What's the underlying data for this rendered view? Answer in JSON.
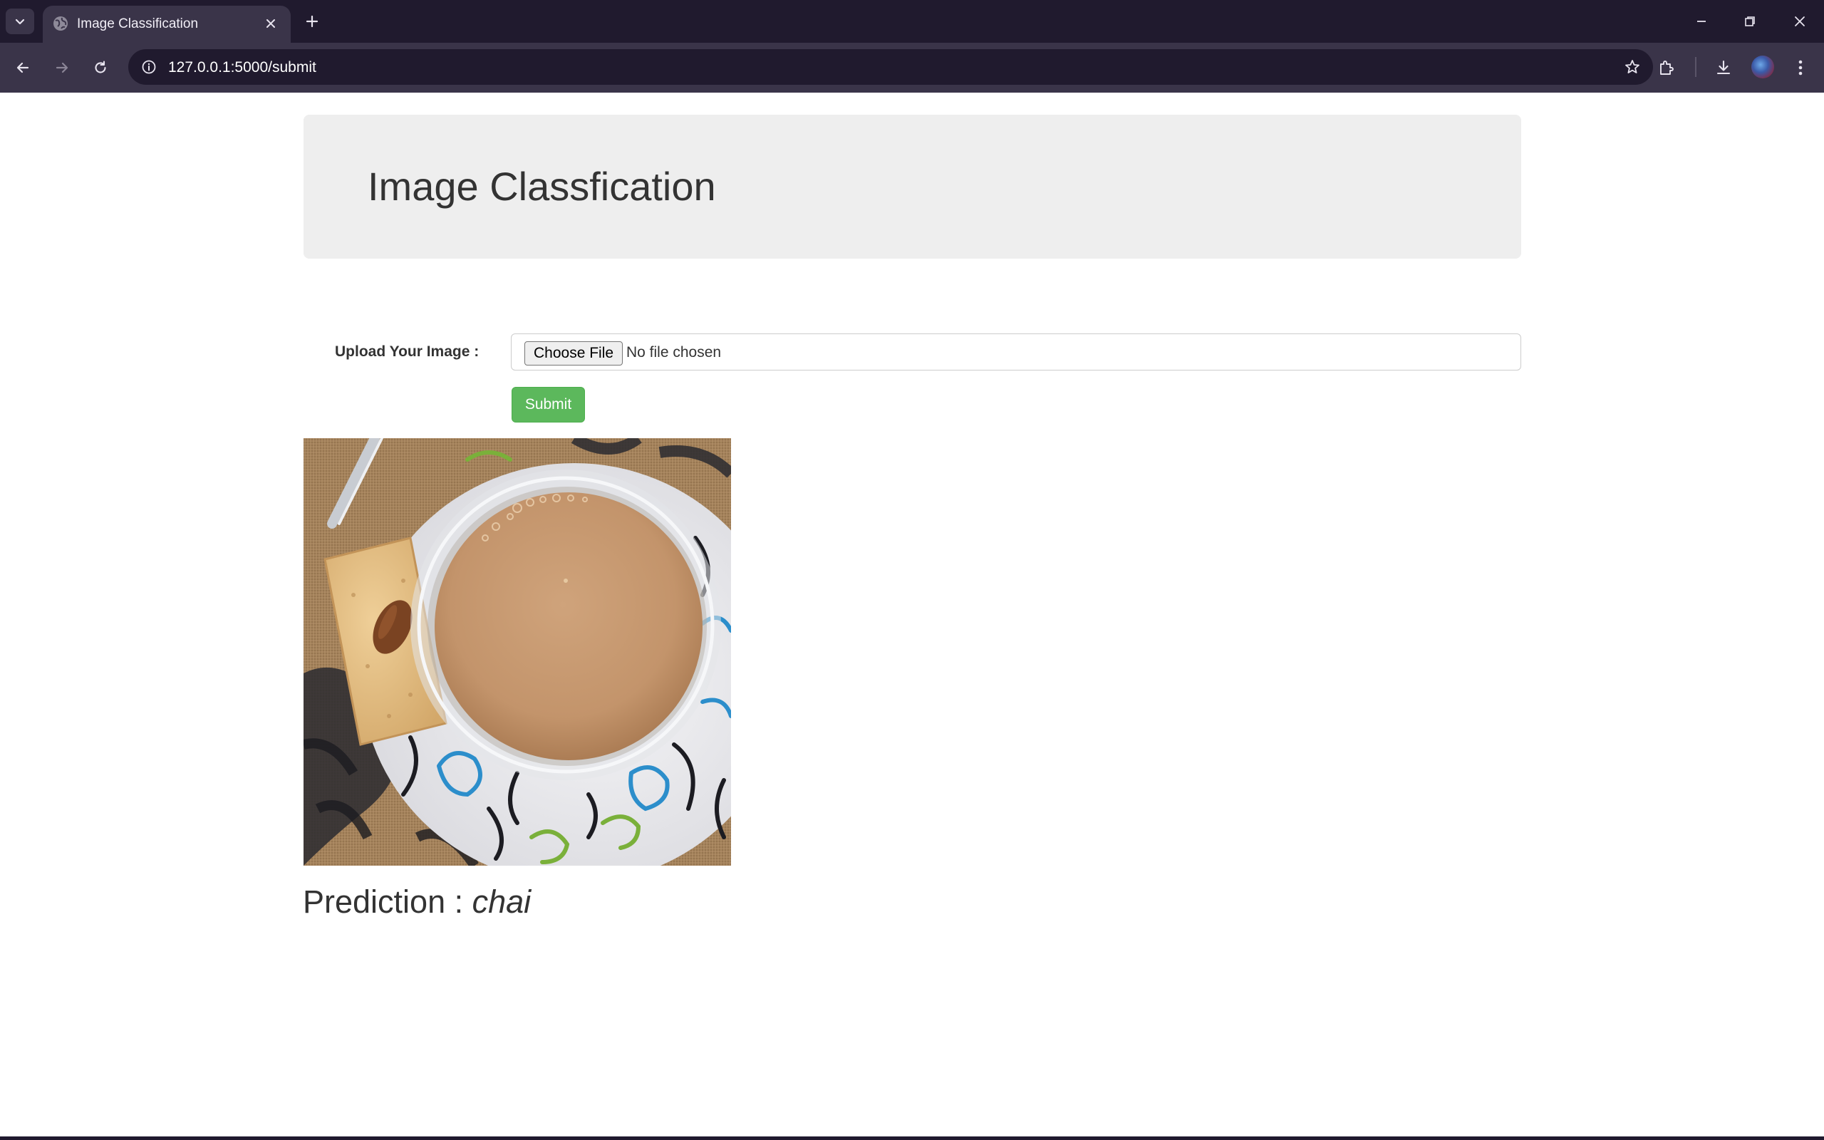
{
  "browser": {
    "tab": {
      "title": "Image Classification"
    },
    "address_bar": {
      "url": "127.0.0.1:5000/submit"
    },
    "theme": {
      "frame": "#201a2e",
      "toolbar": "#3a3449"
    }
  },
  "page": {
    "header": {
      "title": "Image Classfication"
    },
    "form": {
      "upload_label": "Upload Your Image :",
      "choose_file_label": "Choose File",
      "no_file_text": "No file chosen",
      "submit_label": "Submit",
      "submit_color": "#5cb85c"
    },
    "result": {
      "prefix": "Prediction : ",
      "label": "chai"
    }
  }
}
